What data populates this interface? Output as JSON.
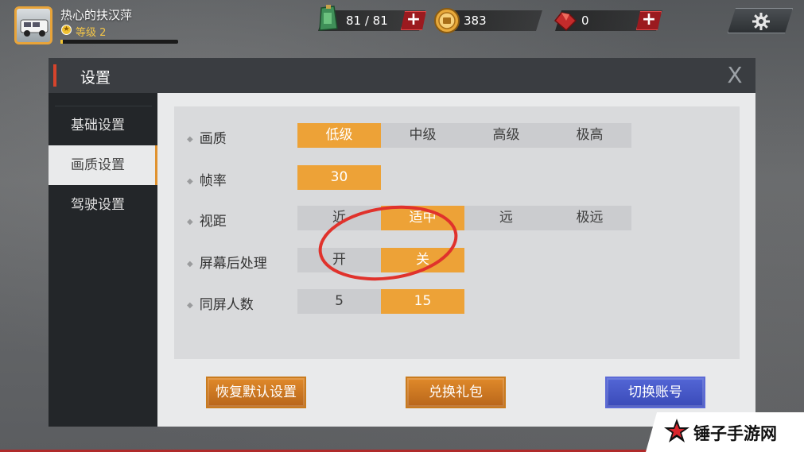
{
  "hud": {
    "player_name": "热心的扶汉萍",
    "level_text": "等级 2",
    "stamina": "81 / 81",
    "coins": "383",
    "gems": "0",
    "icons": {
      "avatar": "van-avatar-icon",
      "stamina": "fuel-can-icon",
      "coin": "gold-coin-icon",
      "gem": "ruby-gem-icon",
      "settings": "gear-icon"
    }
  },
  "window": {
    "title": "设置",
    "close_label": "X"
  },
  "sidebar": {
    "items": [
      {
        "label": "基础设置",
        "active": false
      },
      {
        "label": "画质设置",
        "active": true
      },
      {
        "label": "驾驶设置",
        "active": false
      }
    ]
  },
  "settings": [
    {
      "label": "画质",
      "options": [
        "低级",
        "中级",
        "高级",
        "极高"
      ],
      "selected": 0
    },
    {
      "label": "帧率",
      "options": [
        "30"
      ],
      "selected": 0
    },
    {
      "label": "视距",
      "options": [
        "近",
        "适中",
        "远",
        "极远"
      ],
      "selected": 1
    },
    {
      "label": "屏幕后处理",
      "options": [
        "开",
        "关"
      ],
      "selected": 1
    },
    {
      "label": "同屏人数",
      "options": [
        "5",
        "15"
      ],
      "selected": 1
    }
  ],
  "buttons": {
    "reset": "恢复默认设置",
    "redeem": "兑换礼包",
    "switch_account": "切换账号"
  },
  "watermark": {
    "text": "锤子手游网"
  },
  "colors": {
    "accent_orange": "#eda237",
    "blue_button": "#4a5cd0",
    "annotation_red": "#e0322c"
  }
}
